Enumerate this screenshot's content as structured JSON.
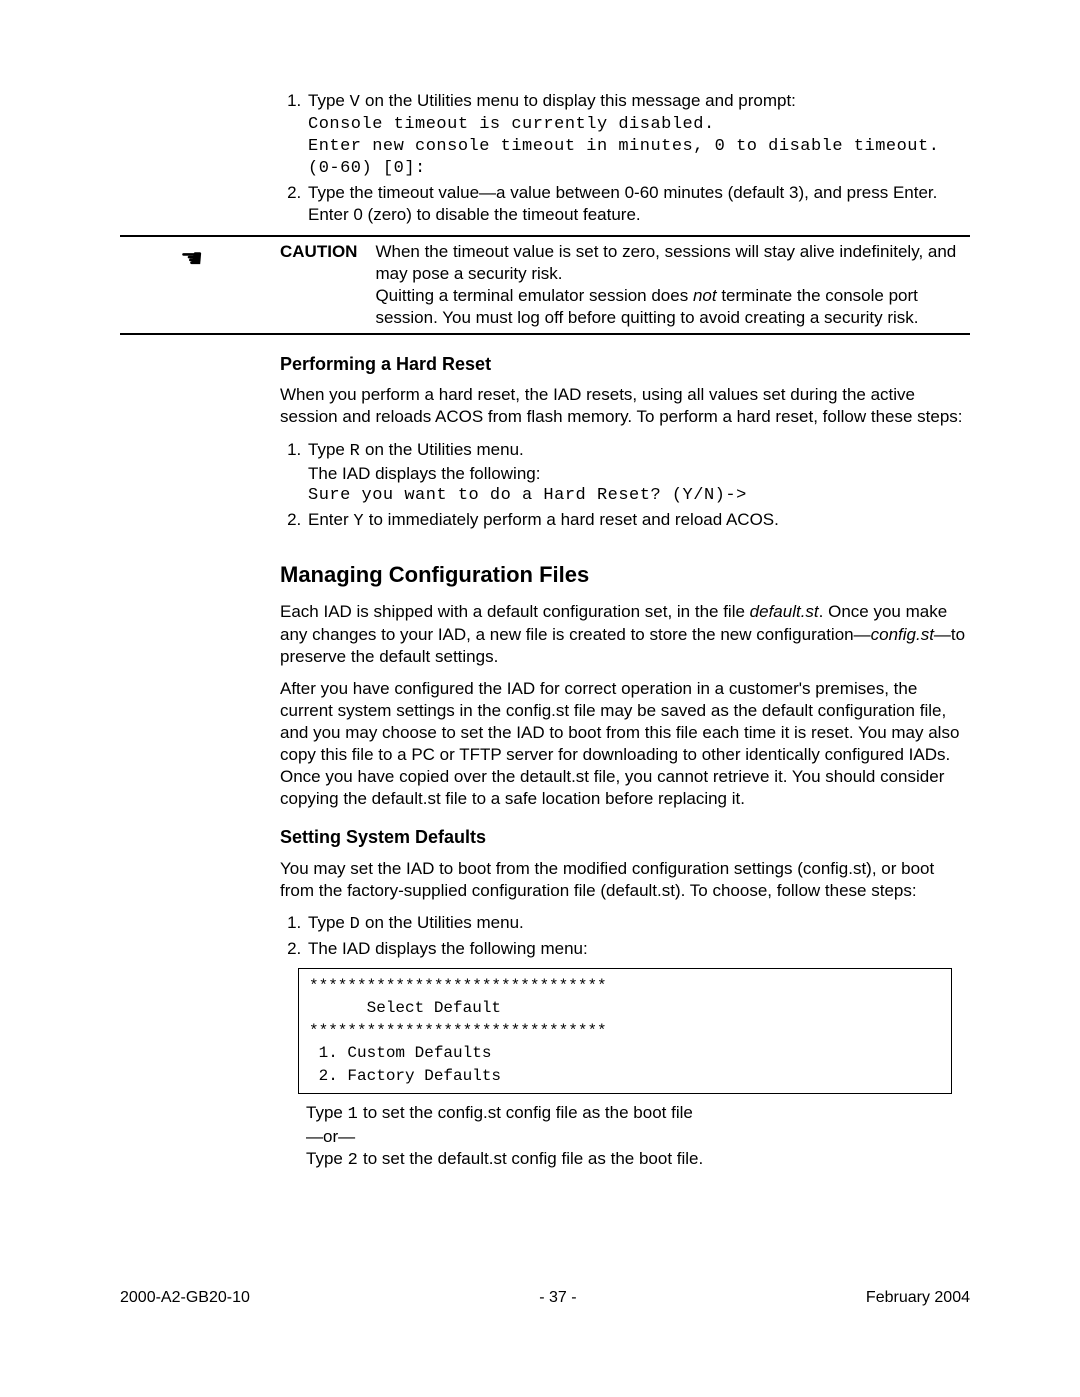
{
  "step1": {
    "pre": "Type ",
    "key": "V",
    "post": " on the Utilities menu to display this message and prompt:",
    "code1": "Console timeout is currently disabled.",
    "code2": "Enter new console timeout in minutes, 0 to disable timeout. (0-60) [0]:"
  },
  "step2": "Type the timeout value—a value between 0-60 minutes (default 3), and press Enter. Enter 0 (zero) to disable the timeout feature.",
  "caution": {
    "label": "CAUTION",
    "line1": "When the timeout value is set to zero, sessions will stay alive indefinitely, and may pose a security risk.",
    "line2a": "Quitting a terminal emulator session does ",
    "not": "not",
    "line2b": " terminate the console port session. You must log off before quitting to avoid creating a security risk."
  },
  "hardReset": {
    "heading": "Performing a Hard Reset",
    "intro": "When you perform a hard reset, the IAD resets, using all values set during the active session and reloads ACOS from flash memory. To perform a hard reset, follow these steps:",
    "s1pre": "Type ",
    "s1key": "R",
    "s1post": " on the Utilities menu.",
    "s1line2": "The IAD displays the following:",
    "s1code": "Sure you want to do a Hard Reset? (Y/N)->",
    "s2pre": "Enter ",
    "s2key": "Y",
    "s2post": " to immediately perform a hard reset and reload ACOS."
  },
  "managing": {
    "heading": "Managing Configuration Files",
    "p1a": "Each IAD is shipped with a default configuration set, in the file ",
    "p1file": "default.st",
    "p1b": ". Once you make any changes to your IAD, a new file is created to store the new configuration—",
    "p1file2": "config.st",
    "p1c": "—to preserve the default settings.",
    "p2": "After you have configured the IAD for correct operation in a customer's premises, the current system settings in the config.st file may be saved as the default configuration file, and you may choose to set the IAD to boot from this file each time it is reset. You may also copy this file to a PC or TFTP server for downloading to other identically configured IADs. Once you have copied over the detault.st file, you cannot retrieve it. You should consider copying the default.st file to a safe location before replacing it."
  },
  "defaults": {
    "heading": "Setting System Defaults",
    "intro": "You may set the IAD to boot from the modified configuration settings (config.st), or boot from the factory-supplied configuration file (default.st). To choose, follow these steps:",
    "s1pre": "Type ",
    "s1key": "D",
    "s1post": " on the Utilities menu.",
    "s2": "The IAD displays the following menu:",
    "menu": "*******************************\n      Select Default\n*******************************\n 1. Custom Defaults\n 2. Factory Defaults",
    "aft1a": "Type ",
    "aft1key": "1",
    "aft1b": " to set the config.st config file as the boot file",
    "or": "—or—",
    "aft2a": "Type ",
    "aft2key": "2",
    "aft2b": " to set the default.st config file as the boot file."
  },
  "footer": {
    "left": "2000-A2-GB20-10",
    "center": "- 37 -",
    "right": "February 2004"
  }
}
